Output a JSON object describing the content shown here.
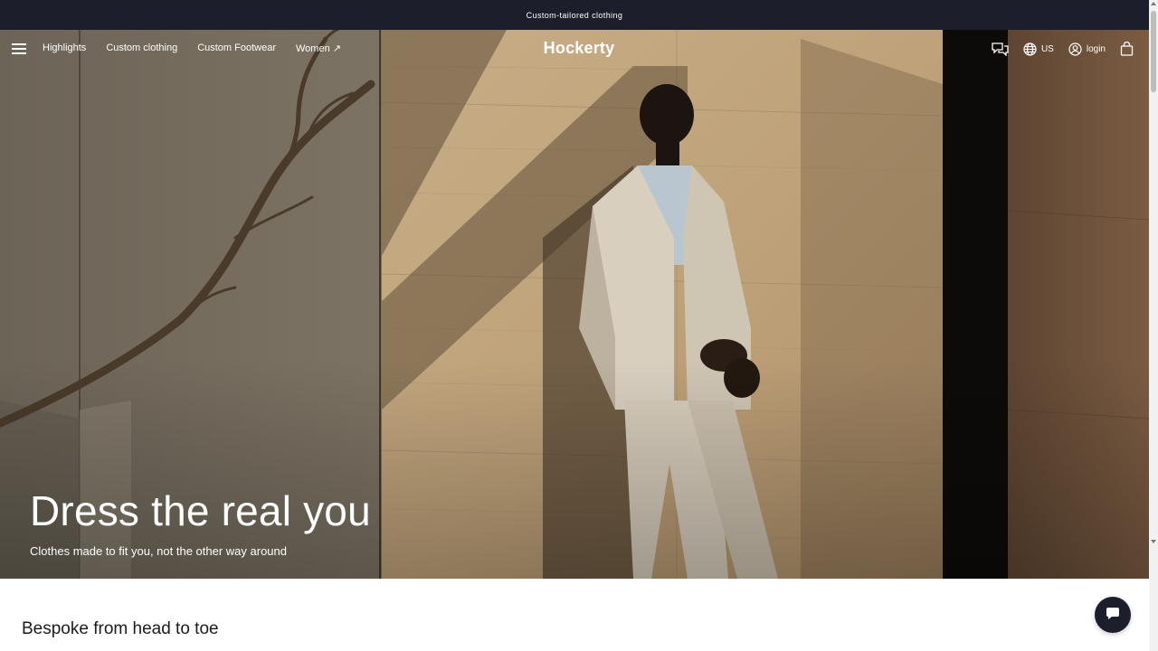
{
  "announcement": {
    "text": "Custom-tailored clothing"
  },
  "nav": {
    "menu_icon": "hamburger-menu-icon",
    "links": [
      {
        "label": "Highlights"
      },
      {
        "label": "Custom clothing"
      },
      {
        "label": "Custom Footwear"
      },
      {
        "label": "Women ↗"
      }
    ],
    "logo": "Hockerty",
    "right": {
      "chat_icon": "chat-bubbles-icon",
      "region_icon": "globe-icon",
      "region_label": "US",
      "account_icon": "user-circle-icon",
      "login_label": "login",
      "cart_icon": "shopping-bag-icon"
    }
  },
  "hero": {
    "headline": "Dress the real you",
    "subline": "Clothes made to fit you, not the other way around"
  },
  "section": {
    "title": "Bespoke from head to toe"
  },
  "chat_fab": {
    "icon": "chat-bubble-icon"
  },
  "colors": {
    "announcement_bg": "#1c1e2b",
    "text_light": "#ffffff",
    "text_dark": "#1b1b1b",
    "fab_bg": "#1c1e2b"
  }
}
